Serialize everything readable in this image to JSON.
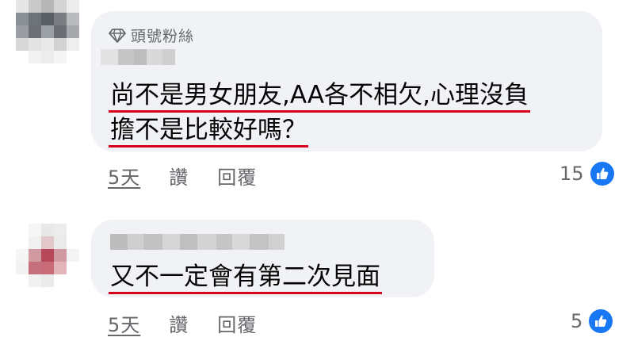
{
  "comments": [
    {
      "badge_label": "頭號粉絲",
      "lines": [
        "尚不是男女朋友,AA各不相欠,心理沒負",
        "擔不是比較好嗎？"
      ],
      "time": "5天",
      "like_action": "讚",
      "reply_action": "回覆",
      "reaction_count": "15",
      "reaction_icon": "like-thumb-icon"
    },
    {
      "lines": [
        "又不一定會有第二次見面"
      ],
      "time": "5天",
      "like_action": "讚",
      "reply_action": "回覆",
      "reaction_count": "5",
      "reaction_icon": "like-thumb-icon"
    }
  ],
  "colors": {
    "bubble": "#f0f2f5",
    "underline": "#d6001c",
    "like_blue": "#1877f2",
    "meta_text": "#65676b"
  }
}
